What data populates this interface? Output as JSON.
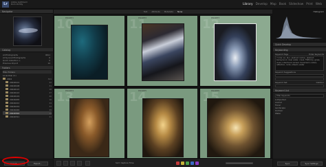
{
  "app": {
    "logo": "Lr",
    "catalog_lines": [
      "Adobe Lightroom",
      "Dom Christy"
    ]
  },
  "modules": [
    {
      "label": "Library",
      "active": true
    },
    {
      "label": "Develop",
      "active": false
    },
    {
      "label": "Map",
      "active": false
    },
    {
      "label": "Book",
      "active": false
    },
    {
      "label": "Slideshow",
      "active": false
    },
    {
      "label": "Print",
      "active": false
    },
    {
      "label": "Web",
      "active": false
    }
  ],
  "left_panel": {
    "navigator_title": "Navigator",
    "catalog_title": "Catalog",
    "catalog_items": [
      {
        "label": "All Photographs",
        "count": "4611"
      },
      {
        "label": "All Synced Photographs",
        "count": "0"
      },
      {
        "label": "Quick Collection +",
        "count": "0"
      },
      {
        "label": "Previous Import",
        "count": "14"
      }
    ],
    "folders_title": "Folders",
    "filter_folders": "Filter Folders",
    "volume": "Local Disk (C:)",
    "folders": [
      {
        "label": "2024",
        "count": "341",
        "selected": false
      },
      {
        "label": "20240101",
        "count": "22",
        "selected": false
      },
      {
        "label": "20240108",
        "count": "31",
        "selected": false
      },
      {
        "label": "20240115",
        "count": "18",
        "selected": false
      },
      {
        "label": "20240122",
        "count": "27",
        "selected": false
      },
      {
        "label": "20240129",
        "count": "40",
        "selected": false
      },
      {
        "label": "20240205",
        "count": "16",
        "selected": false
      },
      {
        "label": "20240212",
        "count": "24",
        "selected": false
      },
      {
        "label": "20240219",
        "count": "33",
        "selected": false
      },
      {
        "label": "20240226",
        "count": "29",
        "selected": false
      },
      {
        "label": "20240304",
        "count": "14",
        "selected": true
      },
      {
        "label": "20240311",
        "count": "21",
        "selected": false
      }
    ],
    "import_label": "Import...",
    "export_label": "Export..."
  },
  "center": {
    "filter_bar": [
      "Text",
      "Attribute",
      "Metadata",
      "None"
    ],
    "cells": [
      {
        "num": "10",
        "file": "DSC4871",
        "selected": false
      },
      {
        "num": "11",
        "file": "DSC4872",
        "selected": false
      },
      {
        "num": "12",
        "file": "DSC4873",
        "selected": true
      },
      {
        "num": "13",
        "file": "DSC4874",
        "selected": false
      },
      {
        "num": "14",
        "file": "DSC4875",
        "selected": false
      },
      {
        "num": "15",
        "file": "DSC4876",
        "selected": false
      }
    ],
    "sort_label": "Sort: Capture Time"
  },
  "right_panel": {
    "histogram_title": "Histogram",
    "quick_develop_title": "Quick Develop",
    "keywording_title": "Keywording",
    "keyword_tags_label": "Keyword Tags",
    "keyword_tags_value": "Enter Keywords",
    "keywords_text": "7 mile run, blur, abstract motion, abstract background, clear water, creek, FSBS trip, grass, loose, intentional camera movement, nature, reflection, rocks, stream, water",
    "keyword_suggestions": "Keyword Suggestions",
    "keyword_set_label": "Keyword Set",
    "keyword_set_value": "Outdoor",
    "keyword_list_title": "Keyword List",
    "keyword_filter": "Filter Keywords",
    "keyword_list": [
      "A-Imported",
      "Animal",
      "Floral",
      "Landscape",
      "Outdoor",
      "Water"
    ],
    "sync_label": "Sync",
    "sync_settings_label": "Sync Settings"
  }
}
